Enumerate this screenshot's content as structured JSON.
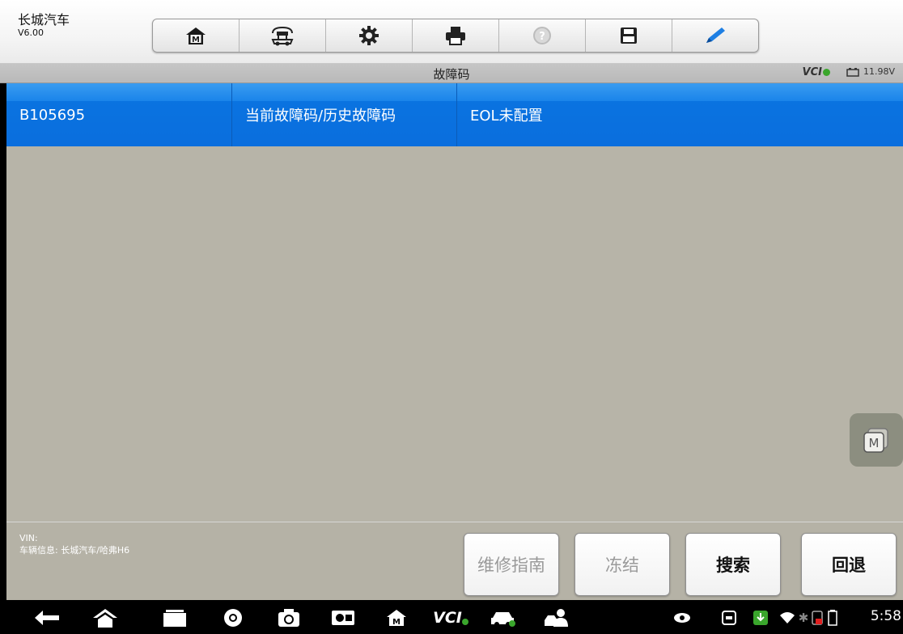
{
  "app": {
    "name": "长城汽车",
    "version": "V6.00"
  },
  "toolbar": {
    "items": [
      {
        "icon": "home-m-icon"
      },
      {
        "icon": "car-lift-icon"
      },
      {
        "icon": "gear-icon"
      },
      {
        "icon": "printer-icon"
      },
      {
        "icon": "help-icon"
      },
      {
        "icon": "save-icon"
      },
      {
        "icon": "pen-icon"
      }
    ]
  },
  "titlebar": {
    "title": "故障码",
    "vci_label": "VCI",
    "battery": "11.98V"
  },
  "dtc": {
    "rows": [
      {
        "code": "B105695",
        "status": "当前故障码/历史故障码",
        "description": "EOL未配置"
      }
    ]
  },
  "footer": {
    "vin_label": "VIN:",
    "vehicle_info": "车辆信息: 长城汽车/哈弗H6",
    "buttons": {
      "guide": "维修指南",
      "freeze": "冻结",
      "search": "搜索",
      "back": "回退"
    }
  },
  "system": {
    "time": "5:58",
    "nav_vci_label": "VCI"
  }
}
